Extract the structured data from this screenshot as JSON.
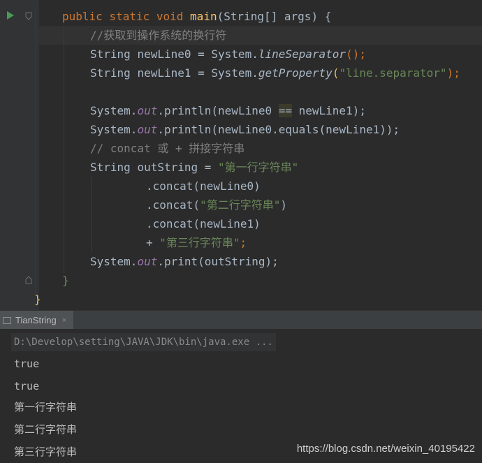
{
  "editor": {
    "lines": [
      {
        "t1": "public",
        "t2": "static",
        "t3": "void",
        "fn": "main",
        "rest": "(String[] args) {"
      },
      {
        "comment": "//获取到操作系统的换行符"
      },
      {
        "type": "String",
        "var": "newLine0 = System.",
        "method": "lineSeparator",
        "tail": "();"
      },
      {
        "type": "String",
        "var": "newLine1 = System.",
        "method": "getProperty",
        "arg": "\"line.separator\"",
        "tail": ");"
      },
      {
        "a": "System.",
        "out": "out",
        "b": ".println(newLine0 ",
        "op": "==",
        "c": " newLine1);"
      },
      {
        "a": "System.",
        "out": "out",
        "b": ".println(newLine0.equals(newLine1));"
      },
      {
        "comment": "// concat 或 + 拼接字符串"
      },
      {
        "type": "String",
        "var": "outString = ",
        "str": "\"第一行字符串\""
      },
      {
        "a": ".concat(newLine0)"
      },
      {
        "a": ".concat(",
        "str": "\"第二行字符串\"",
        "b": ")"
      },
      {
        "a": ".concat(newLine1)"
      },
      {
        "a": "+ ",
        "str": "\"第三行字符串\"",
        "b": ";"
      },
      {
        "a": "System.",
        "out": "out",
        "b": ".print(outString);"
      },
      {
        "brace": "}"
      },
      {
        "brace": "}"
      }
    ]
  },
  "console": {
    "tab_label": "TianString",
    "tab_close": "×",
    "command": "D:\\Develop\\setting\\JAVA\\JDK\\bin\\java.exe ...",
    "output": [
      "true",
      "true",
      "第一行字符串",
      "第二行字符串",
      "第三行字符串"
    ]
  },
  "watermark": "https://blog.csdn.net/weixin_40195422",
  "colors": {
    "background": "#2b2b2b",
    "keyword": "#cc7832",
    "function": "#ffc66d",
    "string": "#6a8759",
    "comment": "#808080",
    "static_field": "#9876aa",
    "run_icon": "#499c54"
  }
}
